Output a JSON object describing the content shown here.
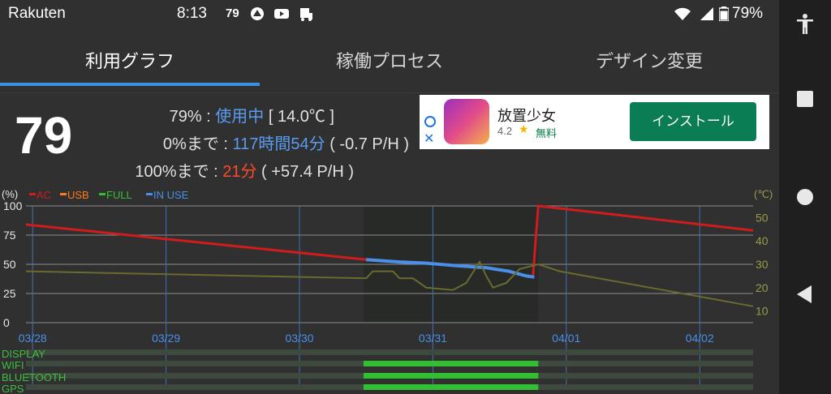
{
  "status_bar": {
    "carrier": "Rakuten",
    "time": "8:13",
    "badge": "79",
    "battery": "79%",
    "icons": [
      "alert-icon",
      "youtube-icon",
      "notification-icon",
      "wifi-icon",
      "signal-icon",
      "battery-icon"
    ]
  },
  "tabs": [
    {
      "label": "利用グラフ",
      "active": true
    },
    {
      "label": "稼働プロセス",
      "active": false
    },
    {
      "label": "デザイン変更",
      "active": false
    }
  ],
  "summary": {
    "level": "79",
    "row1": {
      "prefix": "79% : ",
      "value": "使用中",
      "suffix": " [ 14.0℃ ]"
    },
    "row2": {
      "prefix": "0%まで : ",
      "value": "117時間54分",
      "suffix": " ( -0.7 P/H )"
    },
    "row3": {
      "prefix": "100%まで : ",
      "value": "21分",
      "suffix": " ( +57.4 P/H )"
    }
  },
  "ad": {
    "title": "放置少女",
    "rating": "4.2",
    "star": "★",
    "price": "無料",
    "install": "インストール",
    "close": "✕"
  },
  "colors": {
    "ac": "#d01c1c",
    "usb": "#ff7a1a",
    "full": "#32c032",
    "in_use": "#4a8fe8",
    "temp": "#6b6b2e",
    "active_tab": "#3d8fe0"
  },
  "chart_data": {
    "type": "line",
    "left_unit": "(%)",
    "right_unit": "(℃)",
    "legend": [
      "AC",
      "USB",
      "FULL",
      "IN USE"
    ],
    "y_left_ticks": [
      "100",
      "75",
      "50",
      "25",
      "0"
    ],
    "y_right_ticks": [
      "50",
      "40",
      "30",
      "20",
      "10"
    ],
    "ylim": [
      0,
      100
    ],
    "y2lim": [
      5,
      55
    ],
    "x_labels": [
      "03/28",
      "03/29",
      "03/30",
      "03/31",
      "04/01",
      "04/02"
    ],
    "x_domain": [
      0,
      5.45
    ],
    "highlight_range": [
      2.53,
      3.84
    ],
    "series": [
      {
        "name": "AC",
        "points": [
          [
            0.0,
            84
          ],
          [
            2.55,
            54
          ]
        ],
        "color_key": "ac"
      },
      {
        "name": "AC",
        "points": [
          [
            3.8,
            39
          ],
          [
            3.82,
            70
          ],
          [
            3.84,
            100
          ],
          [
            5.45,
            79
          ]
        ],
        "color_key": "ac"
      },
      {
        "name": "IN USE",
        "points": [
          [
            2.55,
            54
          ],
          [
            2.8,
            52
          ],
          [
            3.0,
            51
          ],
          [
            3.2,
            49
          ],
          [
            3.45,
            47
          ],
          [
            3.62,
            44
          ],
          [
            3.75,
            40
          ],
          [
            3.81,
            39
          ]
        ],
        "color_key": "in_use"
      },
      {
        "name": "temp",
        "axis": "right",
        "points": [
          [
            0.0,
            27
          ],
          [
            2.55,
            24
          ],
          [
            2.6,
            27
          ],
          [
            2.75,
            27
          ],
          [
            2.8,
            24
          ],
          [
            2.9,
            24
          ],
          [
            2.95,
            22
          ],
          [
            3.0,
            20
          ],
          [
            3.2,
            19
          ],
          [
            3.3,
            22
          ],
          [
            3.4,
            31
          ],
          [
            3.45,
            25
          ],
          [
            3.5,
            20
          ],
          [
            3.6,
            22
          ],
          [
            3.7,
            28
          ],
          [
            3.84,
            30
          ],
          [
            4.0,
            27
          ],
          [
            5.45,
            12
          ]
        ],
        "color_key": "temp"
      }
    ],
    "status_rows": [
      "DISPLAY",
      "WIFI",
      "BLUETOOTH",
      "GPS"
    ],
    "status_on": {
      "WIFI": [
        [
          2.53,
          3.84
        ]
      ],
      "BLUETOOTH": [
        [
          2.53,
          3.84
        ]
      ],
      "GPS": [
        [
          2.53,
          3.84
        ]
      ]
    }
  }
}
